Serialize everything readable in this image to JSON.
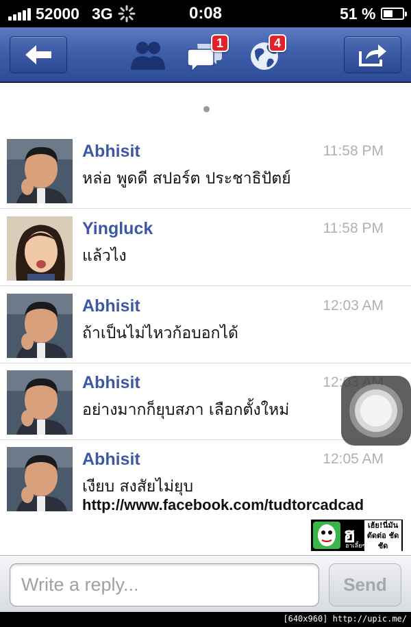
{
  "status_bar": {
    "carrier": "52000",
    "network": "3G",
    "time": "0:08",
    "battery_percent": "51 %",
    "battery_level": 0.51
  },
  "nav": {
    "messages_badge": "1",
    "notifications_badge": "4"
  },
  "messages": [
    {
      "sender": "Abhisit",
      "time": "11:58 PM",
      "text": "หล่อ พูดดี สปอร์ต ประชาธิปัตย์"
    },
    {
      "sender": "Yingluck",
      "time": "11:58 PM",
      "text": "แล้วไง"
    },
    {
      "sender": "Abhisit",
      "time": "12:03 AM",
      "text": "ถ้าเป็นไม่ไหวก้อบอกได้"
    },
    {
      "sender": "Abhisit",
      "time": "12:03 AM",
      "text": "อย่างมากก็ยุบสภา เลือกตั้งใหม่"
    },
    {
      "sender": "Abhisit",
      "time": "12:05 AM",
      "text": "เงียบ สงสัยไม่ยุบ"
    }
  ],
  "watermark": {
    "url": "http://www.facebook.com/tudtorcadcad",
    "logo_big": "ฮ",
    "logo_small": "ฮาเลี้ยๆ",
    "logo_right": "เฮ้ย!นี่มัน ตัดต่อ ชัดชัด"
  },
  "composer": {
    "placeholder": "Write a reply...",
    "send_label": "Send"
  },
  "footer": {
    "text": "[640x960] http://upic.me/"
  },
  "colors": {
    "nav_blue": "#3f5ea9",
    "sender_blue": "#3b59a5",
    "badge_red": "#e0232b"
  }
}
